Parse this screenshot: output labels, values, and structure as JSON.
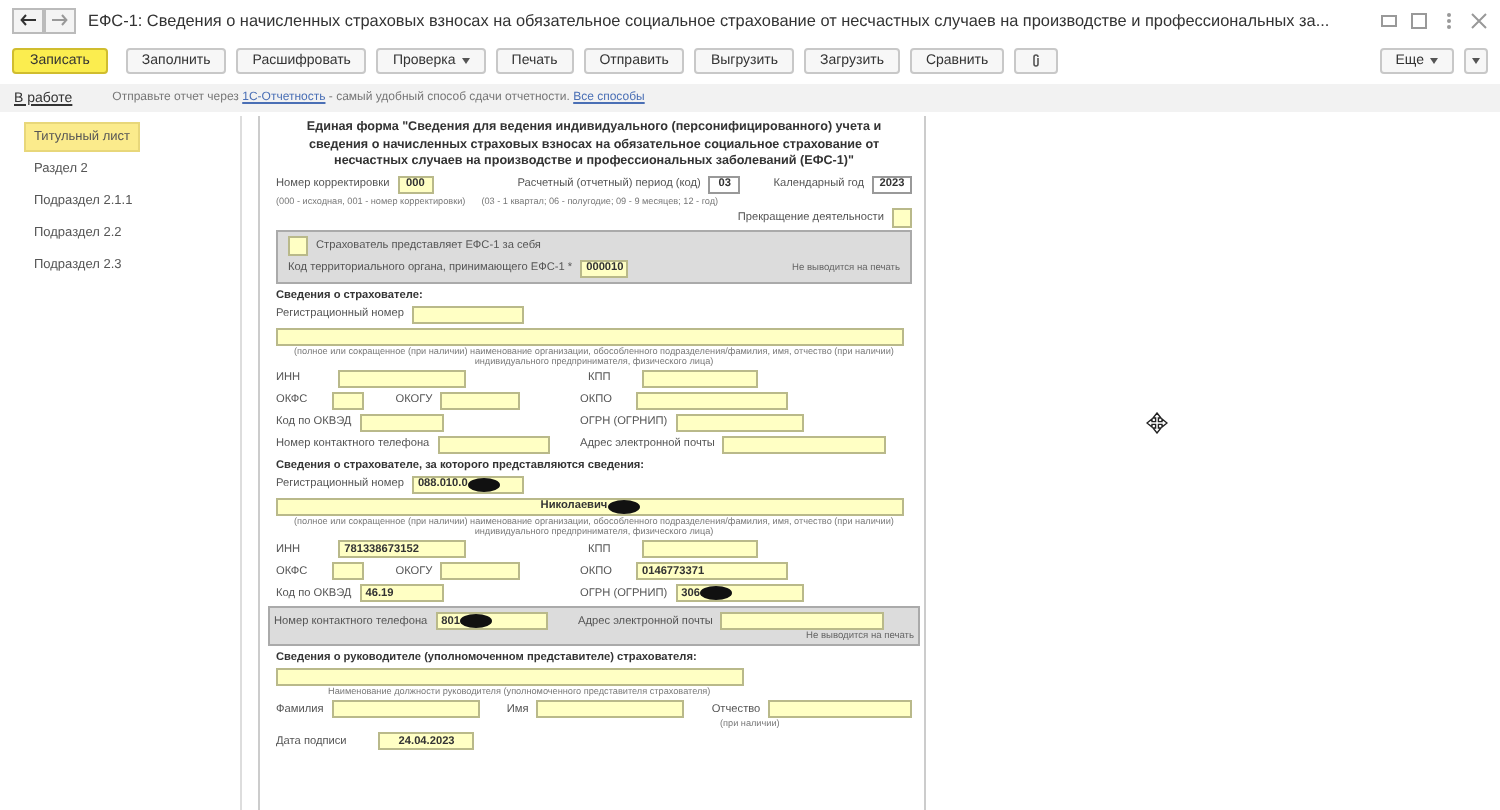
{
  "window": {
    "title": "ЕФС-1: Сведения о начисленных страховых взносах на обязательное социальное страхование от несчастных случаев на производстве и профессиональных за..."
  },
  "toolbar": {
    "buttons": [
      {
        "label": "Записать",
        "kind": "primary"
      },
      {
        "label": "Заполнить",
        "kind": "normal"
      },
      {
        "label": "Расшифровать",
        "kind": "normal"
      },
      {
        "label": "Проверка",
        "kind": "dropdown"
      },
      {
        "label": "Печать",
        "kind": "normal"
      },
      {
        "label": "Отправить",
        "kind": "normal"
      },
      {
        "label": "Выгрузить",
        "kind": "normal"
      },
      {
        "label": "Загрузить",
        "kind": "normal"
      },
      {
        "label": "Сравнить",
        "kind": "normal"
      }
    ],
    "more": "Еще"
  },
  "status_link": "В работе",
  "info": {
    "before": "Отправьте отчет через",
    "link": "1С-Отчетность",
    "middle": "- самый удобный способ сдачи отчетности.",
    "link2": "Все способы"
  },
  "sidebar": {
    "items": [
      {
        "label": "Титульный лист",
        "selected": true
      },
      {
        "label": "Раздел 2",
        "selected": false
      },
      {
        "label": "Подраздел 2.1.1",
        "selected": false
      },
      {
        "label": "Подраздел 2.2",
        "selected": false
      },
      {
        "label": "Подраздел 2.3",
        "selected": false
      }
    ]
  },
  "form": {
    "heading": "Единая форма \"Сведения для ведения индивидуального (персонифицированного) учета и сведения о начисленных страховых взносах на обязательное социальное страхование от несчастных случаев на производстве и профессиональных заболеваний (ЕФС-1)\"",
    "correction": {
      "label": "Номер корректировки",
      "value": "000",
      "hint": "(000 - исходная, 001 - номер корректировки)"
    },
    "period": {
      "label": "Расчетный (отчетный) период (код)",
      "value": "03",
      "hint": "(03 - 1 квартал; 06 - полугодие; 09 - 9 месяцев; 12 - год)"
    },
    "year": {
      "label": "Календарный год",
      "value": "2023"
    },
    "termination": {
      "label": "Прекращение деятельности",
      "checked": false
    },
    "self_panel": {
      "checkbox_label": "Страхователь представляет ЕФС-1 за себя",
      "checked": false,
      "code_label": "Код территориального органа, принимающего ЕФС-1 *",
      "code_value": "000010",
      "note": "Не выводится на печать"
    },
    "sections": [
      {
        "title": "Сведения о страхователе:",
        "reg": {
          "label": "Регистрационный номер"
        },
        "name_hint": "(полное или сокращенное (при наличии) наименование организации, обособленного подразделения/фамилия, имя, отчество (при наличии) индивидуального предпринимателя, физического лица)",
        "inn": {
          "label": "ИНН"
        },
        "kpp": {
          "label": "КПП"
        },
        "okfs": {
          "label": "ОКФС"
        },
        "okogu": {
          "label": "ОКОГУ"
        },
        "okpo": {
          "label": "ОКПО"
        },
        "okved": {
          "label": "Код по ОКВЭД"
        },
        "ogrn": {
          "label": "ОГРН (ОГРНИП)"
        },
        "phone": {
          "label": "Номер контактного телефона"
        },
        "email": {
          "label": "Адрес электронной почты"
        }
      },
      {
        "title": "Сведения о страхователе, за которого представляются сведения:",
        "reg": {
          "label": "Регистрационный номер",
          "value": "088.010.0",
          "redacted": true
        },
        "name": {
          "value": "Николаевич",
          "redacted": true
        },
        "name_hint": "(полное или сокращенное (при наличии) наименование организации, обособленного подразделения/фамилия, имя, отчество (при наличии) индивидуального предпринимателя, физического лица)",
        "inn": {
          "label": "ИНН",
          "value": "781338673152"
        },
        "kpp": {
          "label": "КПП"
        },
        "okfs": {
          "label": "ОКФС"
        },
        "okogu": {
          "label": "ОКОГУ"
        },
        "okpo": {
          "label": "ОКПО",
          "value": "0146773371"
        },
        "okved": {
          "label": "Код по ОКВЭД",
          "value": "46.19"
        },
        "ogrn": {
          "label": "ОГРН (ОГРНИП)",
          "value": "306",
          "redacted": true
        },
        "phone": {
          "label": "Номер контактного телефона",
          "value": "801",
          "redacted": true
        },
        "email": {
          "label": "Адрес электронной почты"
        },
        "contact_note": "Не выводится на печать"
      }
    ],
    "head": {
      "title": "Сведения о руководителе (уполномоченном представителе) страхователя:",
      "position_hint": "Наименование должности руководителя (уполномоченного представителя страхователя)",
      "surname": "Фамилия",
      "first_name": "Имя",
      "patronymic": "Отчество",
      "patronymic_hint": "(при наличии)",
      "date_label": "Дата подписи",
      "date_value": "24.04.2023"
    }
  }
}
